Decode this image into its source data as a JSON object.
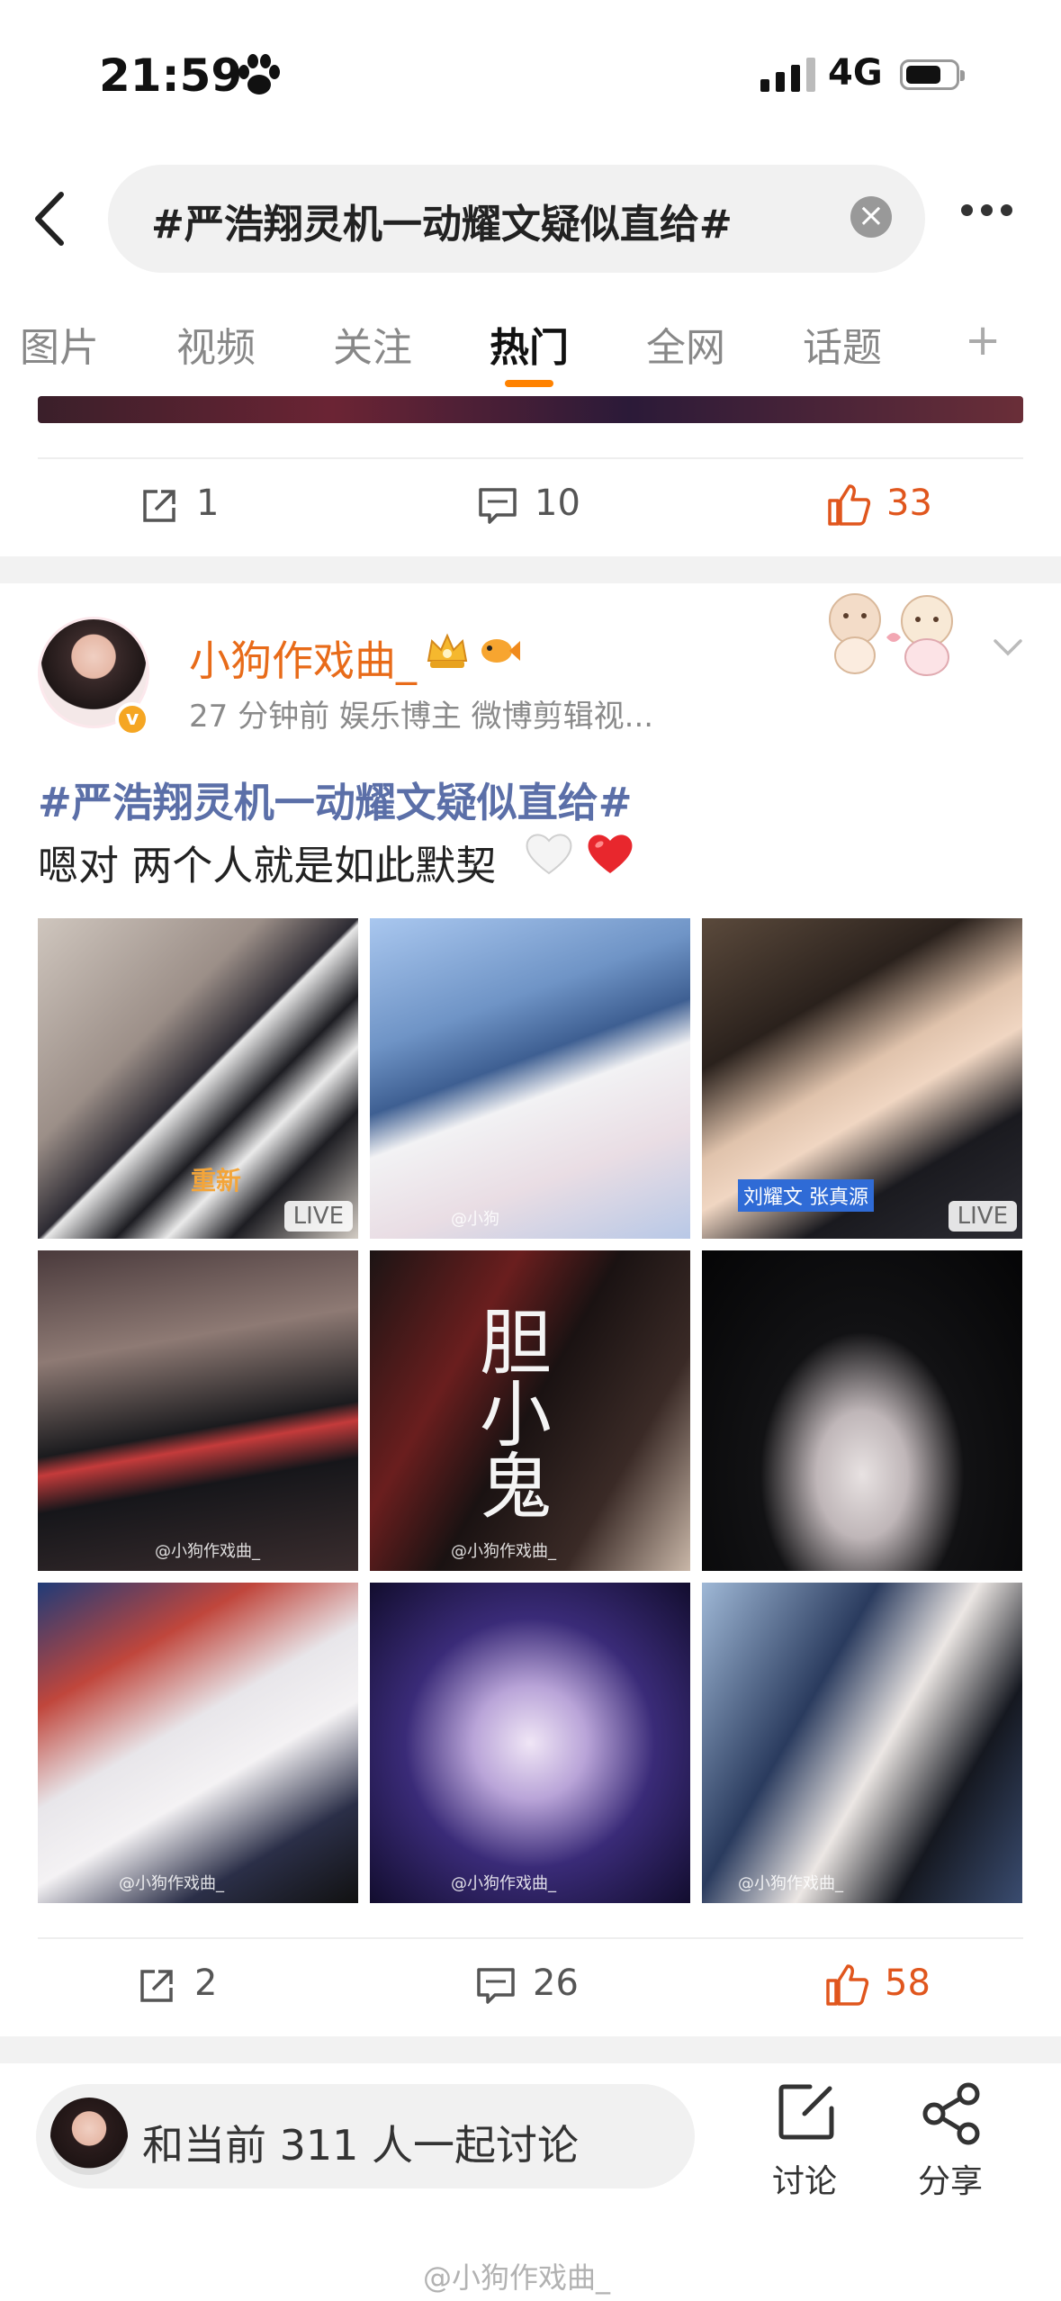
{
  "status_bar": {
    "time": "21:59",
    "network": "4G"
  },
  "search": {
    "query": "#严浩翔灵机一动耀文疑似直给#",
    "clear_icon": "close-icon"
  },
  "tabs": [
    {
      "label": "图片"
    },
    {
      "label": "视频"
    },
    {
      "label": "关注"
    },
    {
      "label": "热门",
      "active": true
    },
    {
      "label": "全网"
    },
    {
      "label": "话题"
    }
  ],
  "tab_add": "+",
  "prev_post": {
    "reposts": "1",
    "comments": "10",
    "likes": "33"
  },
  "post": {
    "username": "小狗作戏曲_",
    "meta": "27 分钟前  娱乐博主 微博剪辑视...",
    "verified_mark": "v",
    "topic": "#严浩翔灵机一动耀文疑似直给#",
    "body": "嗯对 两个人就是如此默契",
    "photos": [
      {
        "live": "LIVE",
        "overlay": "重新"
      },
      {
        "watermark": "@小狗"
      },
      {
        "live": "LIVE",
        "overlay": "刘耀文 张真源"
      },
      {
        "watermark": "@小狗作戏曲_"
      },
      {
        "calligraphy": "胆小鬼",
        "watermark": "@小狗作戏曲_"
      },
      {},
      {
        "watermark": "@小狗作戏曲_"
      },
      {
        "watermark": "@小狗作戏曲_"
      },
      {
        "watermark": "@小狗作戏曲_"
      }
    ],
    "reposts": "2",
    "comments": "26",
    "likes": "58"
  },
  "bottom_bar": {
    "discuss_text": "和当前 311 人一起讨论",
    "discuss_label": "讨论",
    "share_label": "分享"
  },
  "watermark": "@小狗作戏曲_",
  "colors": {
    "accent": "#ff8200",
    "like": "#e0561d",
    "username": "#e86b19",
    "topic": "#5b6fa8"
  }
}
